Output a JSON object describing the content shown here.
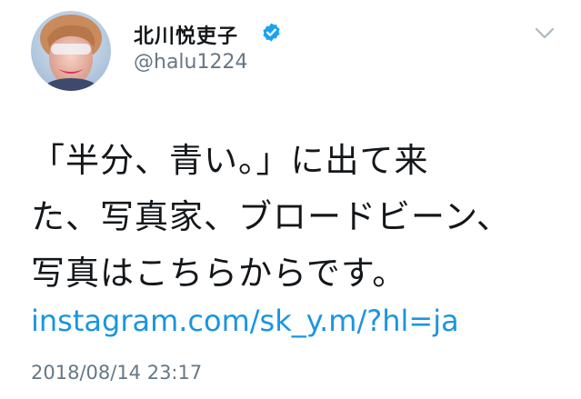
{
  "author": {
    "display_name": "北川悦吏子",
    "handle": "@halu1224",
    "verified": true
  },
  "tweet": {
    "lines": [
      "「半分、青い。」に出て来",
      "た、写真家、ブロードビーン、",
      "写真はこちらからです。"
    ],
    "link": "instagram.com/sk_y.m/?hl=ja",
    "timestamp": "2018/08/14 23:17"
  },
  "colors": {
    "verified_badge": "#1da1f2",
    "link": "#1b95e0",
    "secondary_text": "#657786",
    "chevron": "#aab8c2"
  },
  "icons": {
    "verified": "verified-badge-icon",
    "menu": "chevron-down-icon"
  }
}
